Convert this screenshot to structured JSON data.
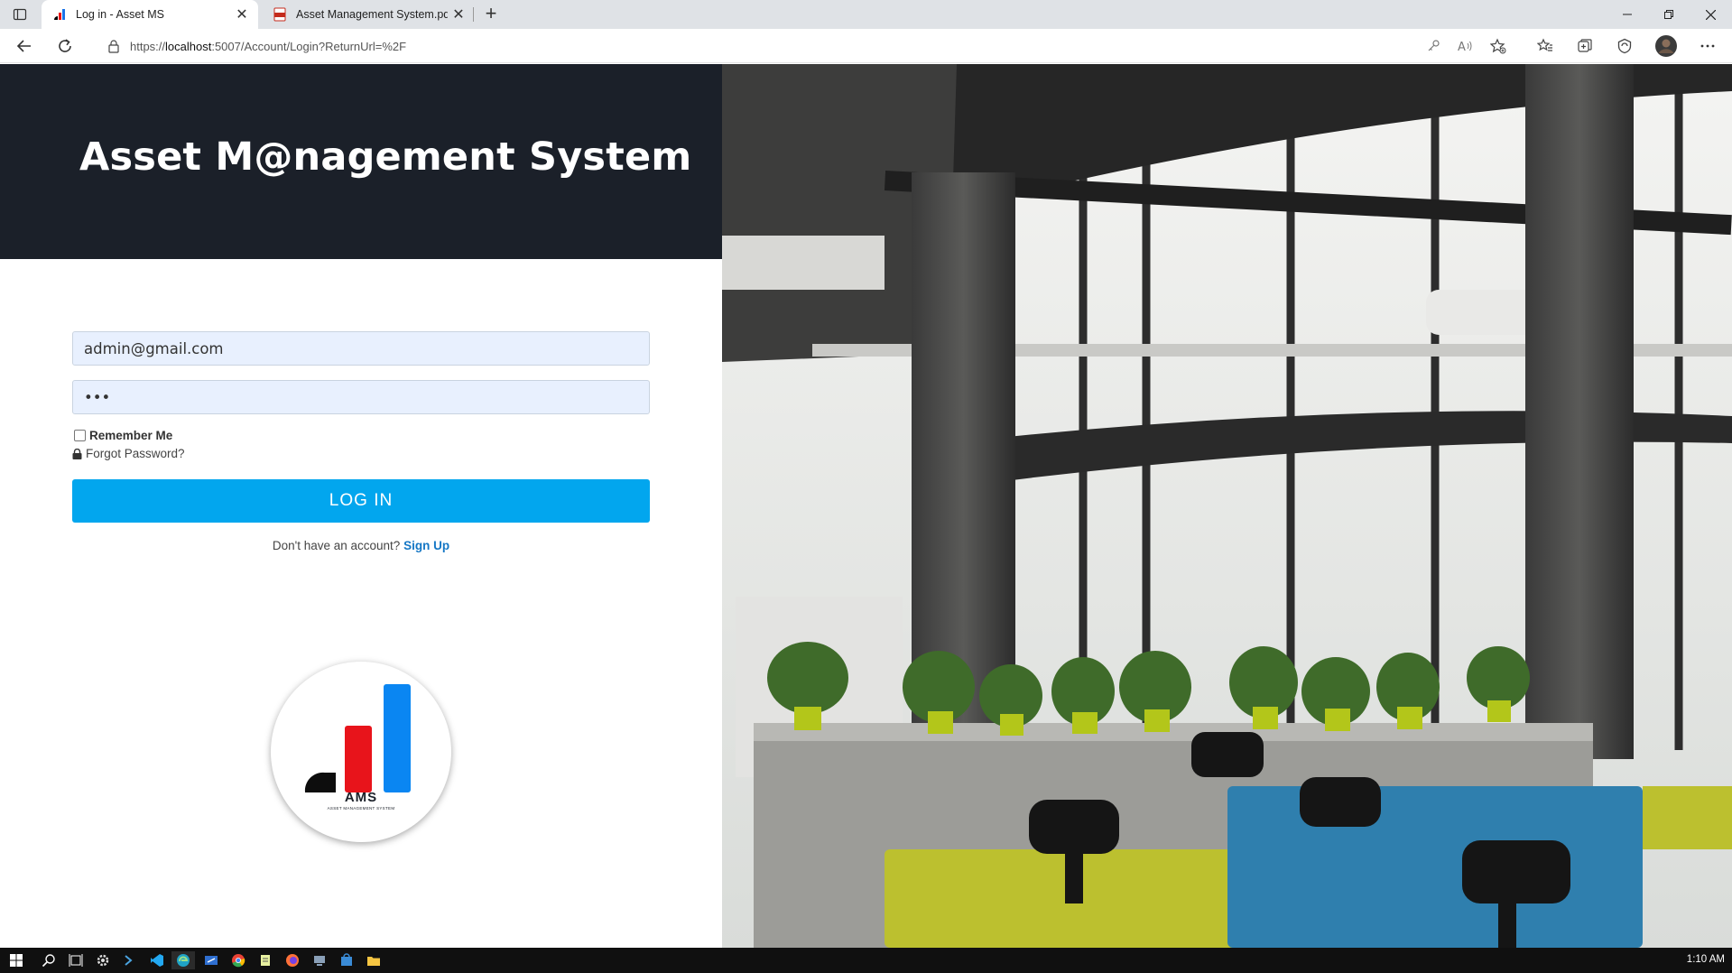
{
  "browser": {
    "tabs": [
      {
        "title": "Log in - Asset MS",
        "active": true
      },
      {
        "title": "Asset Management System.pdf",
        "active": false
      }
    ],
    "address_prefix": "https://",
    "address_host": "localhost",
    "address_rest": ":5007/Account/Login?ReturnUrl=%2F"
  },
  "header": {
    "title": "Asset M@nagement System"
  },
  "login": {
    "email_value": "admin@gmail.com",
    "password_value": "•••",
    "remember_label": "Remember Me",
    "forgot_label": "Forgot Password?",
    "login_button": "LOG IN",
    "signup_prompt": "Don't have an account?",
    "signup_link": "Sign Up"
  },
  "logo": {
    "text": "AMS",
    "subtext": "ASSET MANAGEMENT SYSTEM"
  },
  "taskbar": {
    "clock": "1:10 AM"
  },
  "colors": {
    "header_bg": "#1b2029",
    "login_button": "#02a6ee",
    "link": "#1577c5",
    "field_bg": "#e8f0fe"
  }
}
